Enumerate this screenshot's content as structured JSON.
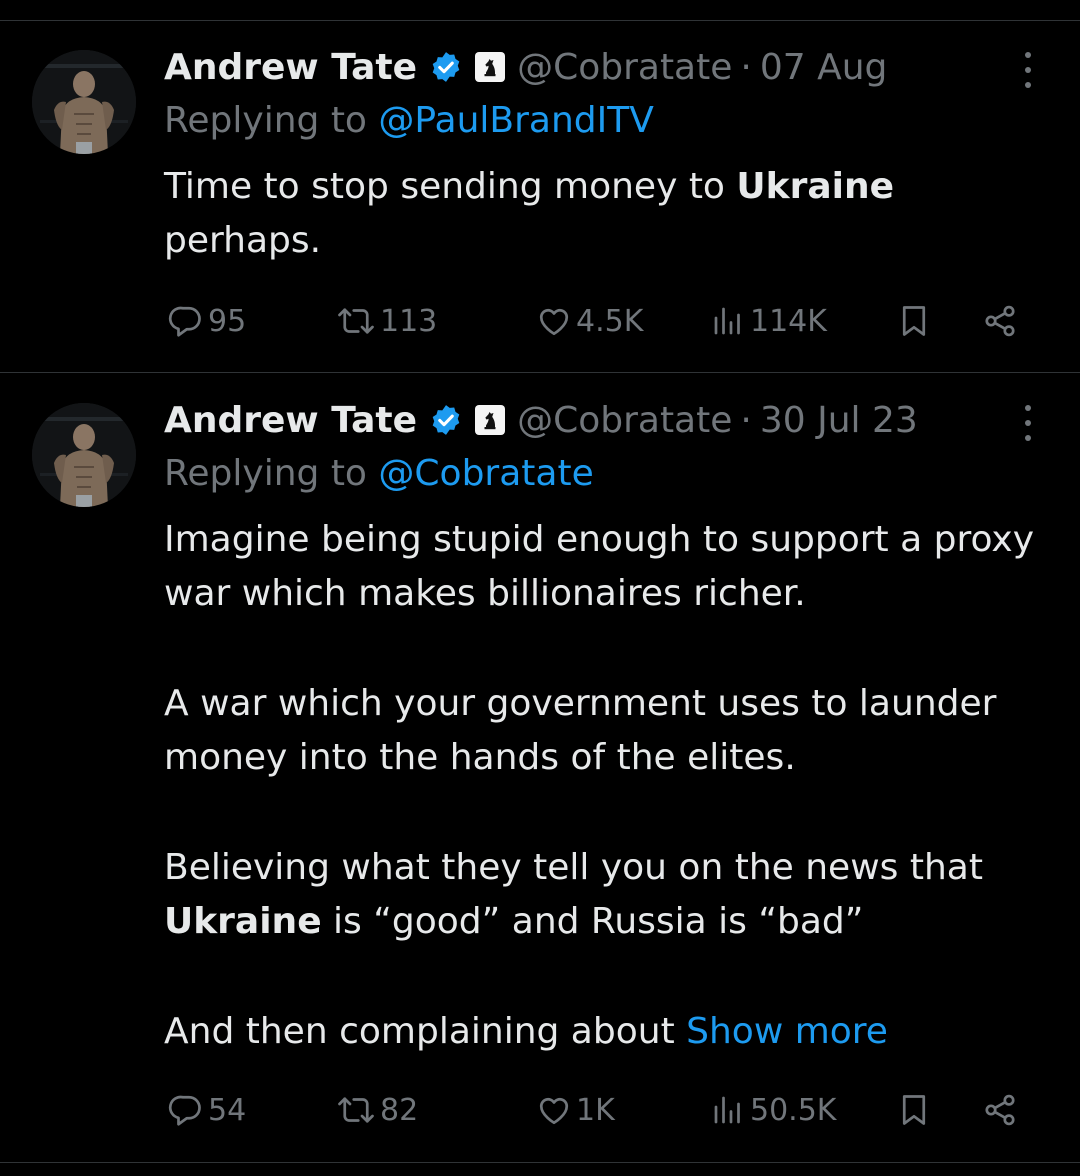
{
  "tweets": [
    {
      "author": {
        "name": "Andrew Tate",
        "handle": "@Cobratate"
      },
      "separator": "·",
      "timestamp": "07 Aug",
      "replying_to": {
        "prefix": "Replying to",
        "mention": "@PaulBrandITV"
      },
      "text": {
        "p1_part1": "Time to stop sending money to ",
        "p1_bold": "Ukraine",
        "p1_part2": " perhaps."
      },
      "stats": {
        "replies": "95",
        "retweets": "113",
        "likes": "4.5K",
        "views": "114K"
      }
    },
    {
      "author": {
        "name": "Andrew Tate",
        "handle": "@Cobratate"
      },
      "separator": "·",
      "timestamp": "30 Jul 23",
      "replying_to": {
        "prefix": "Replying to",
        "mention": "@Cobratate"
      },
      "text": {
        "p1": "Imagine being stupid enough to support a proxy war which makes billionaires richer.",
        "p2": "A war which your government uses to launder money into the hands of the elites.",
        "p3_part1": "Believing what they tell you on the news that ",
        "p3_bold": "Ukraine",
        "p3_part2": " is “good” and Russia is “bad”",
        "p4": "And then complaining about ",
        "show_more": "Show more"
      },
      "stats": {
        "replies": "54",
        "retweets": "82",
        "likes": "1K",
        "views": "50.5K"
      }
    }
  ],
  "colors": {
    "background": "#000000",
    "text": "#e7e9ea",
    "secondary": "#71767b",
    "accent": "#1d9bf0",
    "divider": "#2f3336"
  },
  "icons": [
    "avatar",
    "verified-badge-icon",
    "chess-knight-icon",
    "more-icon",
    "reply-icon",
    "retweet-icon",
    "like-icon",
    "views-icon",
    "bookmark-icon",
    "share-icon"
  ]
}
